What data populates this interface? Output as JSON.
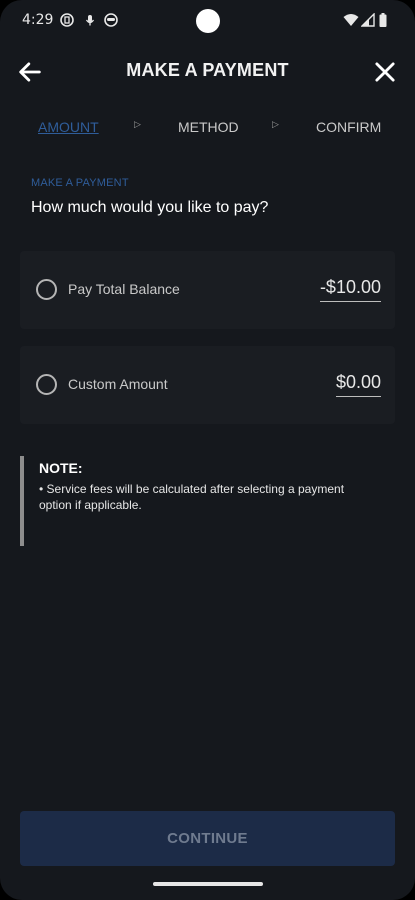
{
  "status_bar": {
    "time": "4:29",
    "icons_left": [
      "sync-badge-icon",
      "mic-icon",
      "face-icon"
    ],
    "icons_right": [
      "wifi-icon",
      "signal-icon",
      "battery-icon"
    ]
  },
  "header": {
    "title": "MAKE A PAYMENT",
    "back_icon": "arrow-left-icon",
    "close_icon": "close-icon"
  },
  "steps": [
    {
      "label": "AMOUNT",
      "active": true
    },
    {
      "label": "METHOD",
      "active": false
    },
    {
      "label": "CONFIRM",
      "active": false
    }
  ],
  "section": {
    "label": "MAKE A PAYMENT",
    "question": "How much would you like to pay?"
  },
  "options": [
    {
      "label": "Pay Total Balance",
      "amount": "-$10.00",
      "selected": false
    },
    {
      "label": "Custom Amount",
      "amount": "$0.00",
      "selected": false
    }
  ],
  "note": {
    "title": "NOTE:",
    "text": "• Service fees will be calculated after selecting a payment option if applicable."
  },
  "continue_label": "CONTINUE",
  "colors": {
    "background": "#15181d",
    "accent": "#2f5d9a",
    "button_bg": "#1c2b47",
    "button_text": "#6f7b8f"
  }
}
